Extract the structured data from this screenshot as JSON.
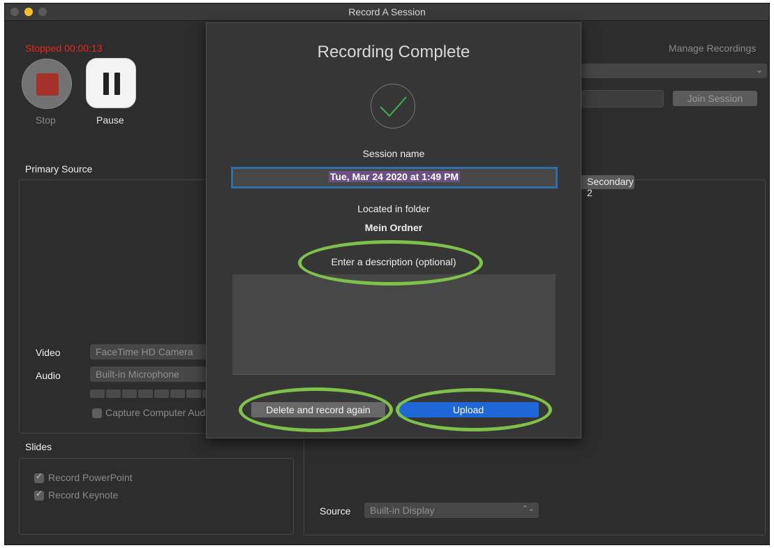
{
  "window": {
    "title": "Record A Session"
  },
  "recorder": {
    "status": "Stopped",
    "timer": "00:00:13",
    "stop_label": "Stop",
    "pause_label": "Pause"
  },
  "header_right": {
    "manage_recordings": "Manage Recordings",
    "join_session": "Join Session"
  },
  "primary": {
    "section_label": "Primary Source",
    "video_label": "Video",
    "video_value": "FaceTime HD Camera",
    "audio_label": "Audio",
    "audio_value": "Built-in Microphone",
    "capture_label": "Capture Computer Audio"
  },
  "secondary": {
    "tab_label": "Secondary 2",
    "source_label": "Source",
    "source_value": "Built-in Display"
  },
  "slides": {
    "section_label": "Slides",
    "record_powerpoint": "Record PowerPoint",
    "record_keynote": "Record Keynote"
  },
  "dialog": {
    "title": "Recording Complete",
    "session_name_label": "Session name",
    "session_name_value": "Tue, Mar 24 2020 at 1:49 PM",
    "folder_label": "Located in folder",
    "folder_value": "Mein Ordner",
    "description_label": "Enter a description (optional)",
    "delete_button": "Delete and record again",
    "upload_button": "Upload"
  },
  "colors": {
    "accent_blue": "#1f66d7",
    "highlight_green": "#7ec24c",
    "status_red": "#e8281c",
    "check_green": "#3fb24f"
  }
}
